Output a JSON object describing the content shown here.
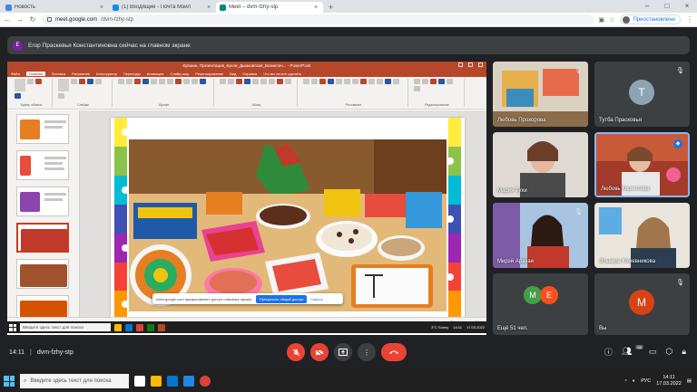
{
  "browser": {
    "tabs": [
      {
        "label": "Новость",
        "color": "#4285f4",
        "active": false
      },
      {
        "label": "(1) Входящие - Почта Мэйл",
        "color": "#168de2",
        "active": false
      },
      {
        "label": "Meet – dvm-fzhy-stp",
        "color": "#00897b",
        "active": true
      }
    ],
    "url_host": "meet.google.com",
    "url_path": "/dvm-fzhy-stp",
    "pause_label": "Приостановлено"
  },
  "banner": {
    "text": "Егор Праскевья Константиновна сейчас на главном экране",
    "avatar_letter": "Е"
  },
  "powerpoint": {
    "title": "Кувшин, Презентация_Кукля_Дымковская_Вознесен... - PowerPoint",
    "menu": [
      "Файл",
      "Главная",
      "Вставка",
      "Рисование",
      "Конструктор",
      "Переходы",
      "Анимация",
      "Слайд-шоу",
      "Рецензирование",
      "Вид",
      "Справка",
      "Что вы хотите сделать"
    ],
    "ribbon_groups": [
      "Буфер обмена",
      "Слайды",
      "Шрифт",
      "Абзац",
      "Рисование",
      "Редактирование"
    ],
    "status": [
      "Заметки",
      "Примечания",
      "81%"
    ],
    "share_notice": "meet.google.com предоставляет доступ к вашему экрану.",
    "share_stop": "Прекратить общий доступ",
    "share_hide": "Скрыть",
    "inner_search": "Введите здесь текст для поиска",
    "inner_weather": "3°C  Sunny",
    "inner_time": "14:11",
    "inner_date": "17.03.2022"
  },
  "participants": [
    {
      "name": "Любовь Прохорова",
      "muted": true
    },
    {
      "name": "Тутба Прасковья",
      "initial": "Т",
      "muted": true
    },
    {
      "name": "Мария Тухи",
      "muted": false
    },
    {
      "name": "Любовь Кириллова",
      "muted": false
    },
    {
      "name": "Мирэй Аракаи",
      "muted": true
    },
    {
      "name": "Эльвира Кожевникова",
      "muted": false
    },
    {
      "name": "Ещё 51 чел.",
      "initials": [
        "M",
        "E"
      ]
    },
    {
      "name": "Вы",
      "initial": "M",
      "muted": true
    }
  ],
  "meeting": {
    "time": "14:11",
    "separator": "|",
    "code": "dvm-fzhy-stp",
    "people_count": "56"
  },
  "taskbar": {
    "search_placeholder": "Введите здесь текст для поиска",
    "time": "14:11",
    "date": "17.03.2022",
    "lang": "РУС"
  },
  "colors": {
    "meet_bg": "#202124",
    "tile_bg": "#3c4043",
    "hangup": "#ea4335",
    "ppt_accent": "#b7472a"
  }
}
